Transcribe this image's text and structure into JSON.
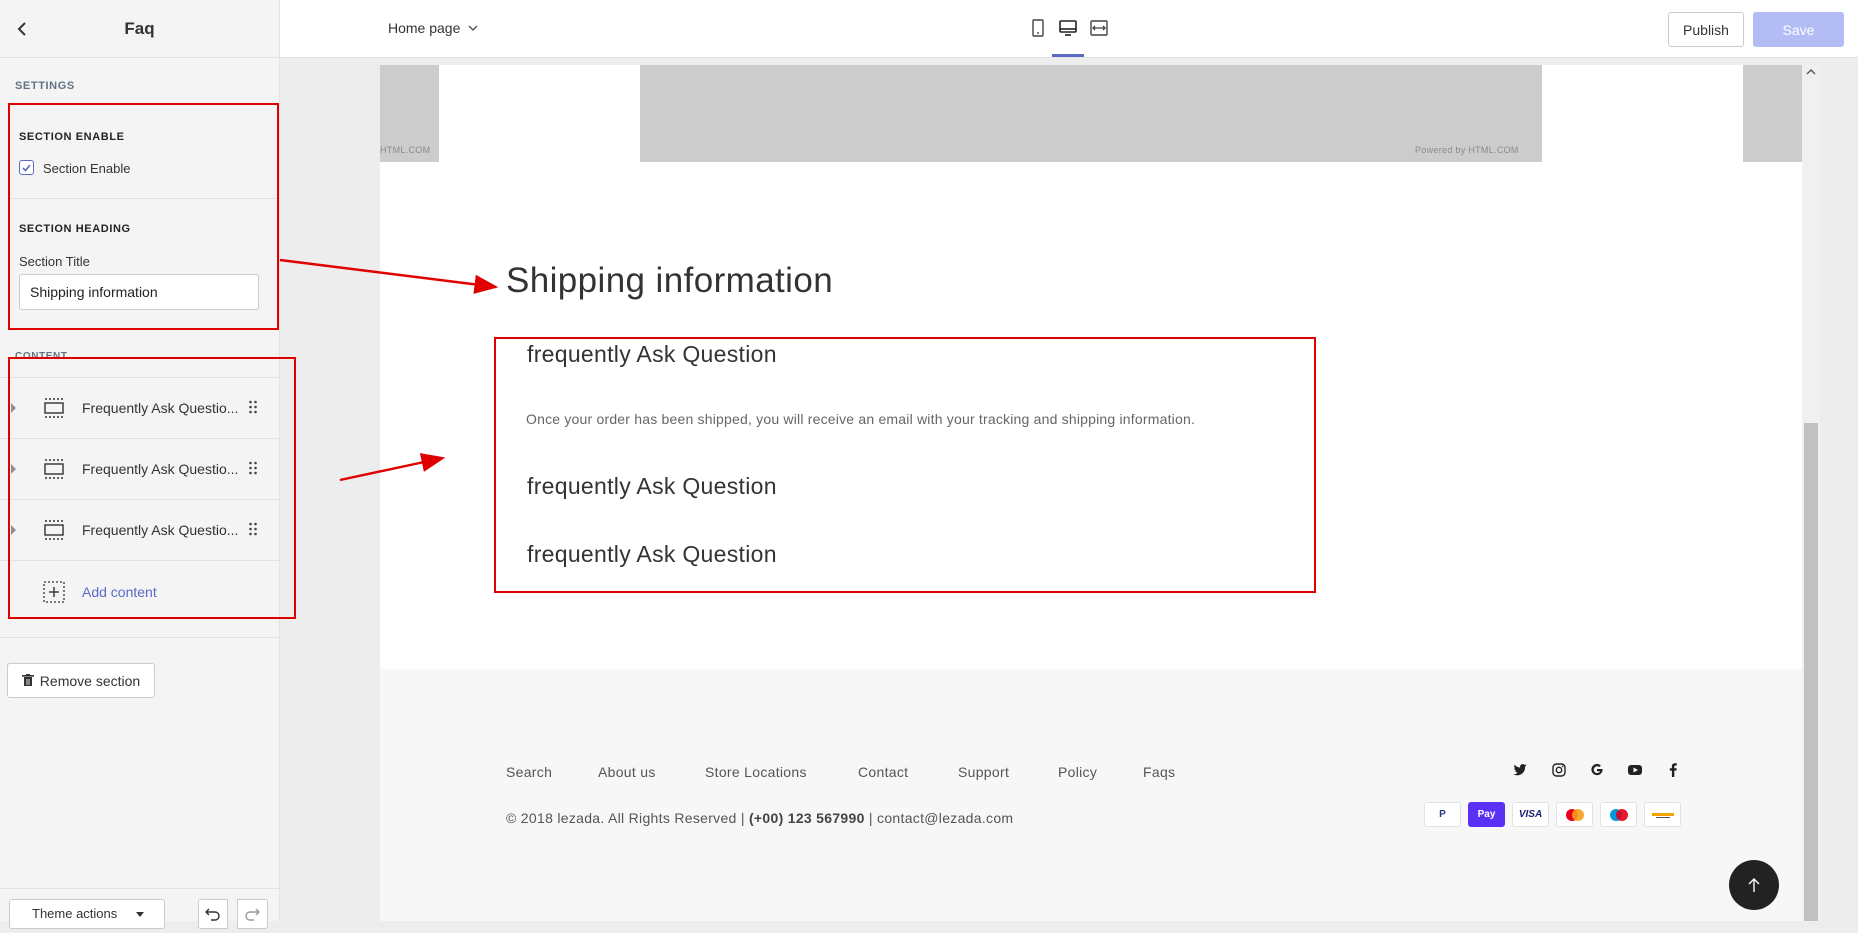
{
  "sidebar": {
    "title": "Faq",
    "settings_caption": "SETTINGS",
    "section_enable_heading": "SECTION ENABLE",
    "section_enable_label": "Section Enable",
    "section_enable_checked": true,
    "section_heading_heading": "SECTION HEADING",
    "section_title_label": "Section Title",
    "section_title_value": "Shipping information",
    "content_caption": "CONTENT",
    "content_blocks": [
      {
        "label": "Frequently Ask Questio..."
      },
      {
        "label": "Frequently Ask Questio..."
      },
      {
        "label": "Frequently Ask Questio..."
      }
    ],
    "add_content_label": "Add content",
    "remove_section_label": "Remove section",
    "theme_actions_label": "Theme actions"
  },
  "topbar": {
    "page_select": "Home page",
    "publish_label": "Publish",
    "save_label": "Save",
    "devices": [
      "mobile-icon",
      "desktop-icon",
      "fullwidth-icon"
    ],
    "accent": "#5c6ac4"
  },
  "preview": {
    "powered_left": "HTML.COM",
    "powered_right": "Powered by HTML.COM",
    "section_title": "Shipping information",
    "faq": [
      {
        "question": "frequently Ask Question",
        "answer": "Once your order has been shipped, you will receive an email with your tracking and shipping information."
      },
      {
        "question": "frequently Ask Question"
      },
      {
        "question": "frequently Ask Question"
      }
    ],
    "footer": {
      "links": [
        "Search",
        "About us",
        "Store Locations",
        "Contact",
        "Support",
        "Policy",
        "Faqs"
      ],
      "copyright_prefix": "© 2018 lezada. All Rights Reserved |",
      "phone": "(+00) 123 567990",
      "email_text": "| contact@lezada.com",
      "social": [
        "twitter-icon",
        "instagram-icon",
        "google-icon",
        "youtube-icon",
        "facebook-icon"
      ],
      "payments": [
        {
          "name": "paypal-icon",
          "text": "P"
        },
        {
          "name": "shopify-pay-icon",
          "text": "Pay"
        },
        {
          "name": "visa-icon",
          "text": "VISA"
        },
        {
          "name": "mastercard-icon",
          "text": ""
        },
        {
          "name": "maestro-icon",
          "text": ""
        },
        {
          "name": "generic-card-icon",
          "text": ""
        }
      ]
    }
  },
  "annotation_color": "#e00000"
}
